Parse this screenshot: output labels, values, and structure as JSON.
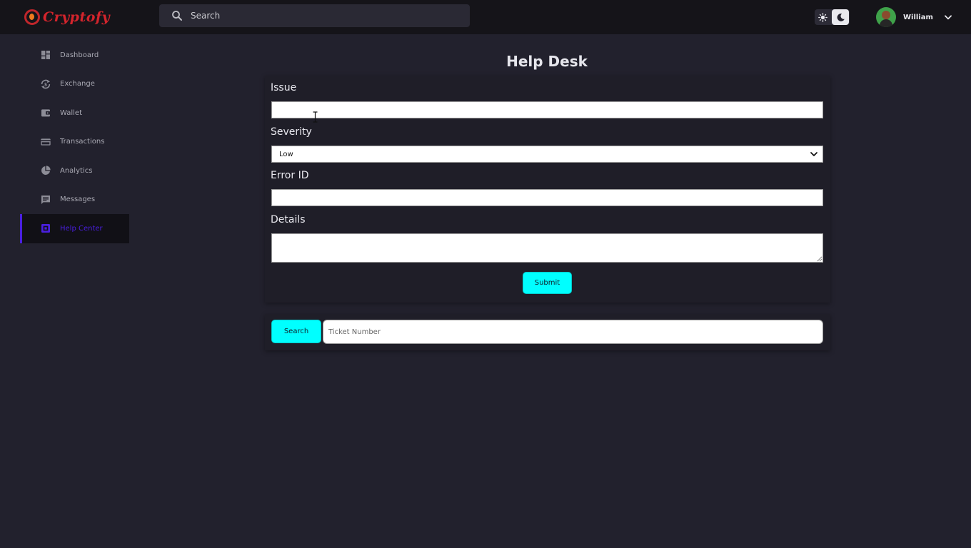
{
  "app": {
    "logo_text": "Cryptofy"
  },
  "topbar": {
    "search_placeholder": "Search",
    "user_name": "William"
  },
  "sidebar": {
    "items": [
      {
        "label": "Dashboard",
        "icon": "dashboard-icon"
      },
      {
        "label": "Exchange",
        "icon": "exchange-icon"
      },
      {
        "label": "Wallet",
        "icon": "wallet-icon"
      },
      {
        "label": "Transactions",
        "icon": "card-icon"
      },
      {
        "label": "Analytics",
        "icon": "pie-chart-icon"
      },
      {
        "label": "Messages",
        "icon": "message-icon"
      },
      {
        "label": "Help Center",
        "icon": "help-icon",
        "active": true
      }
    ]
  },
  "main": {
    "title": "Help Desk",
    "form": {
      "issue_label": "Issue",
      "issue_value": "",
      "severity_label": "Severity",
      "severity_selected": "Low",
      "error_id_label": "Error ID",
      "error_id_value": "",
      "details_label": "Details",
      "details_value": "",
      "submit_label": "Submit"
    },
    "ticket_search": {
      "button_label": "Search",
      "input_placeholder": "Ticket Number"
    }
  },
  "colors": {
    "accent_cyan": "#00ffff",
    "active_nav": "#4a1fe0",
    "logo_red": "#d3242c",
    "background": "#22212d"
  }
}
